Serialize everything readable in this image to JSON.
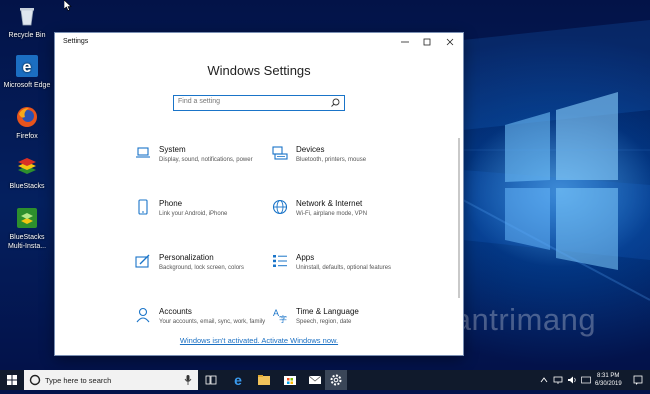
{
  "desktop": {
    "icons": [
      {
        "label": "Recycle Bin",
        "icon": "recycle-bin-icon"
      },
      {
        "label": "Microsoft Edge",
        "icon": "edge-icon"
      },
      {
        "label": "Firefox",
        "icon": "firefox-icon"
      },
      {
        "label": "BlueStacks",
        "icon": "bluestacks-icon"
      },
      {
        "label": "BlueStacks Multi-Insta...",
        "icon": "bluestacks-multi-icon"
      }
    ],
    "watermark": "uantrimang"
  },
  "settings": {
    "window_title": "Settings",
    "heading": "Windows Settings",
    "search_placeholder": "Find a setting",
    "categories": [
      {
        "name": "System",
        "desc": "Display, sound, notifications, power",
        "icon": "laptop-icon"
      },
      {
        "name": "Devices",
        "desc": "Bluetooth, printers, mouse",
        "icon": "keyboard-icon"
      },
      {
        "name": "Phone",
        "desc": "Link your Android, iPhone",
        "icon": "phone-icon"
      },
      {
        "name": "Network & Internet",
        "desc": "Wi-Fi, airplane mode, VPN",
        "icon": "globe-icon"
      },
      {
        "name": "Personalization",
        "desc": "Background, lock screen, colors",
        "icon": "paint-icon"
      },
      {
        "name": "Apps",
        "desc": "Uninstall, defaults, optional features",
        "icon": "apps-list-icon"
      },
      {
        "name": "Accounts",
        "desc": "Your accounts, email, sync, work, family",
        "icon": "person-icon"
      },
      {
        "name": "Time & Language",
        "desc": "Speech, region, date",
        "icon": "time-language-icon"
      }
    ],
    "activation_link": "Windows isn't activated. Activate Windows now."
  },
  "taskbar": {
    "search_placeholder": "Type here to search",
    "apps": [
      "task-view-icon",
      "edge-icon",
      "file-explorer-icon",
      "store-icon",
      "mail-icon",
      "settings-gear-icon"
    ],
    "time": "8:31 PM",
    "date": "6/30/2019"
  },
  "colors": {
    "accent": "#1a74c8",
    "desktop_bg": "#03124a",
    "taskbar_bg": "#101a2c"
  }
}
